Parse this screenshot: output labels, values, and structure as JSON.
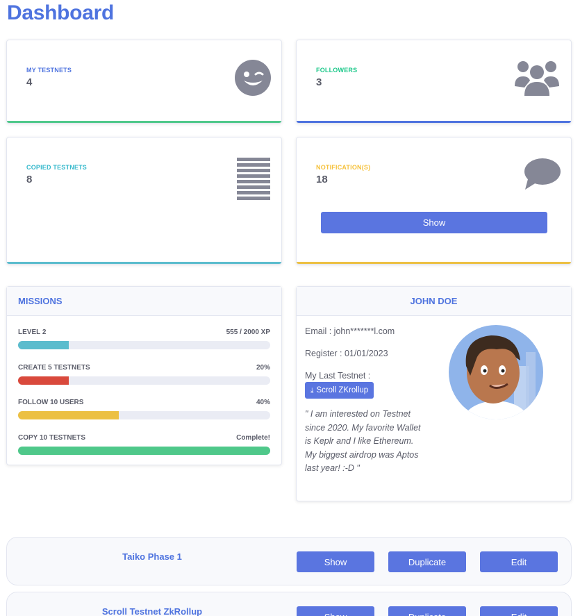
{
  "page": {
    "title": "Dashboard"
  },
  "stats": [
    {
      "label": "MY TESTNETS",
      "value": "4",
      "color": "#1cc88a",
      "icon": "wink-face-icon"
    },
    {
      "label": "FOLLOWERS",
      "value": "3",
      "color": "#4e73df",
      "icon": "users-icon"
    },
    {
      "label": "COPIED TESTNETS",
      "value": "8",
      "color": "#36b9cc",
      "icon": "list-lines-icon"
    },
    {
      "label": "NOTIFICATION(S)",
      "value": "18",
      "color": "#f6c23e",
      "icon": "comment-icon",
      "button": "Show"
    }
  ],
  "missions": {
    "title": "MISSIONS",
    "items": [
      {
        "label": "LEVEL 2",
        "value": "555 / 2000 XP",
        "progress": 0.2,
        "color": "#5bbccd"
      },
      {
        "label": "CREATE 5 TESTNETS",
        "value": "20%",
        "progress": 0.2,
        "color": "#d9493c"
      },
      {
        "label": "FOLLOW 10 USERS",
        "value": "40%",
        "progress": 0.4,
        "color": "#ecc043"
      },
      {
        "label": "COPY 10 TESTNETS",
        "value": "Complete!",
        "progress": 1.0,
        "color": "#4fc88a"
      }
    ]
  },
  "profile": {
    "name": "JOHN DOE",
    "email": "Email : john*******l.com",
    "register": "Register : 01/01/2023",
    "last_testnet_label": "My Last Testnet :",
    "last_testnet": "Scroll ZKrollup",
    "quote": "\" I am interested on Testnet since 2020. My favorite Wallet is Keplr and I like Ethereum. My biggest airdrop was Aptos last year! :-D \""
  },
  "testnets": [
    {
      "name": "Taiko Phase 1",
      "show": "Show",
      "duplicate": "Duplicate",
      "edit": "Edit"
    },
    {
      "name": "Scroll Testnet ZkRollup",
      "show": "Show",
      "duplicate": "Duplicate",
      "edit": "Edit"
    }
  ]
}
